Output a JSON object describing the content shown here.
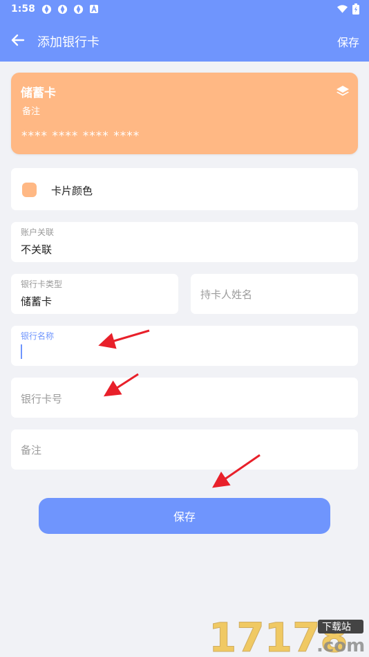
{
  "status": {
    "time": "1:58"
  },
  "appbar": {
    "title": "添加银行卡",
    "save_label": "保存"
  },
  "card_preview": {
    "type": "储蓄卡",
    "note": "备注",
    "number": "**** **** **** ****",
    "color": "#ffb884"
  },
  "form": {
    "card_color_label": "卡片颜色",
    "account_link": {
      "label": "账户关联",
      "value": "不关联"
    },
    "card_type": {
      "label": "银行卡类型",
      "value": "储蓄卡"
    },
    "holder_name": {
      "placeholder": "持卡人姓名"
    },
    "bank_name": {
      "label": "银行名称",
      "value": ""
    },
    "card_number": {
      "placeholder": "银行卡号"
    },
    "note": {
      "placeholder": "备注"
    }
  },
  "save_button": {
    "label": "保存"
  },
  "watermark": {
    "text": "17178",
    "sub": "下载站",
    "domain": ".com"
  },
  "colors": {
    "accent": "#6f95fd",
    "card": "#ffb884",
    "background": "#f1f2f6",
    "arrow": "#e8202a"
  }
}
